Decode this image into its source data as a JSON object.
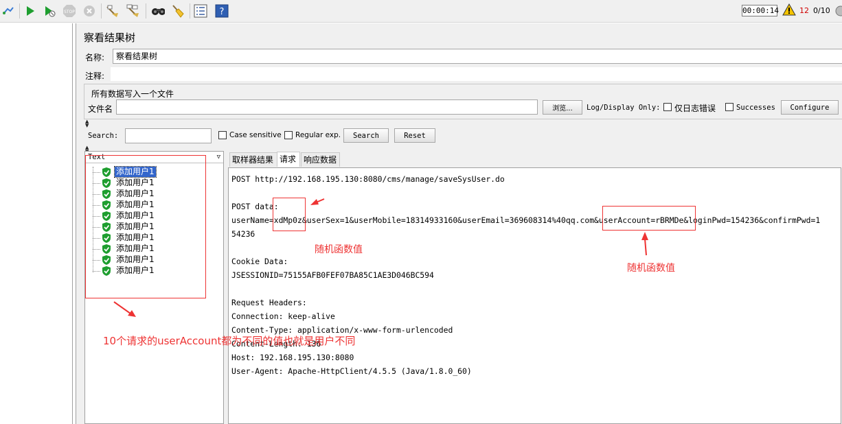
{
  "toolbar": {
    "buttons": [
      "expand-icon",
      "start-icon",
      "start-no-pause-icon",
      "stop-icon",
      "shutdown-icon",
      "clear-icon",
      "clear-all-icon",
      "search-icon",
      "reset-search-icon",
      "function-helper-icon",
      "help-icon"
    ],
    "timer": "00:00:14",
    "error_count": "12",
    "threads": "0/10"
  },
  "panel": {
    "title": "察看结果树",
    "name_label": "名称:",
    "name_value": "察看结果树",
    "comment_label": "注释:",
    "comment_value": "",
    "file_section_title": "所有数据写入一个文件",
    "filename_label": "文件名",
    "filename_value": "",
    "browse_label": "浏览...",
    "log_display_label": "Log/Display Only:",
    "errors_only_label": "仅日志错误",
    "successes_label": "Successes",
    "configure_label": "Configure"
  },
  "search": {
    "label": "Search:",
    "value": "",
    "case_sensitive_label": "Case sensitive",
    "regex_label": "Regular exp.",
    "search_button": "Search",
    "reset_button": "Reset"
  },
  "tree": {
    "renderer": "Text",
    "items": [
      "添加用户1",
      "添加用户1",
      "添加用户1",
      "添加用户1",
      "添加用户1",
      "添加用户1",
      "添加用户1",
      "添加用户1",
      "添加用户1",
      "添加用户1"
    ],
    "selected_index": 0
  },
  "tabs": [
    "取样器结果",
    "请求",
    "响应数据"
  ],
  "active_tab": 1,
  "request_text": "POST http://192.168.195.130:8080/cms/manage/saveSysUser.do\n\nPOST data:\nuserName=xdMp0z&userSex=1&userMobile=18314933160&userEmail=369608314%40qq.com&userAccount=rBRMDe&loginPwd=154236&confirmPwd=1\n54236\n\nCookie Data:\nJSESSIONID=75155AFB0FEF07BA85C1AE3D046BC594\n\nRequest Headers:\nConnection: keep-alive\nContent-Type: application/x-www-form-urlencoded\nContent-Length: 136\nHost: 192.168.195.130:8080\nUser-Agent: Apache-HttpClient/4.5.5 (Java/1.8.0_60)",
  "annotations": {
    "random_value_1": "随机函数值",
    "random_value_2": "随机函数值",
    "note": "10个请求的userAccount都为不同的值也就是用户不同",
    "color": "#ee3333"
  },
  "colors": {
    "selection": "#3366cc",
    "success": "#1e9e2f",
    "error": "#d00000",
    "annotation": "#ee3333"
  }
}
